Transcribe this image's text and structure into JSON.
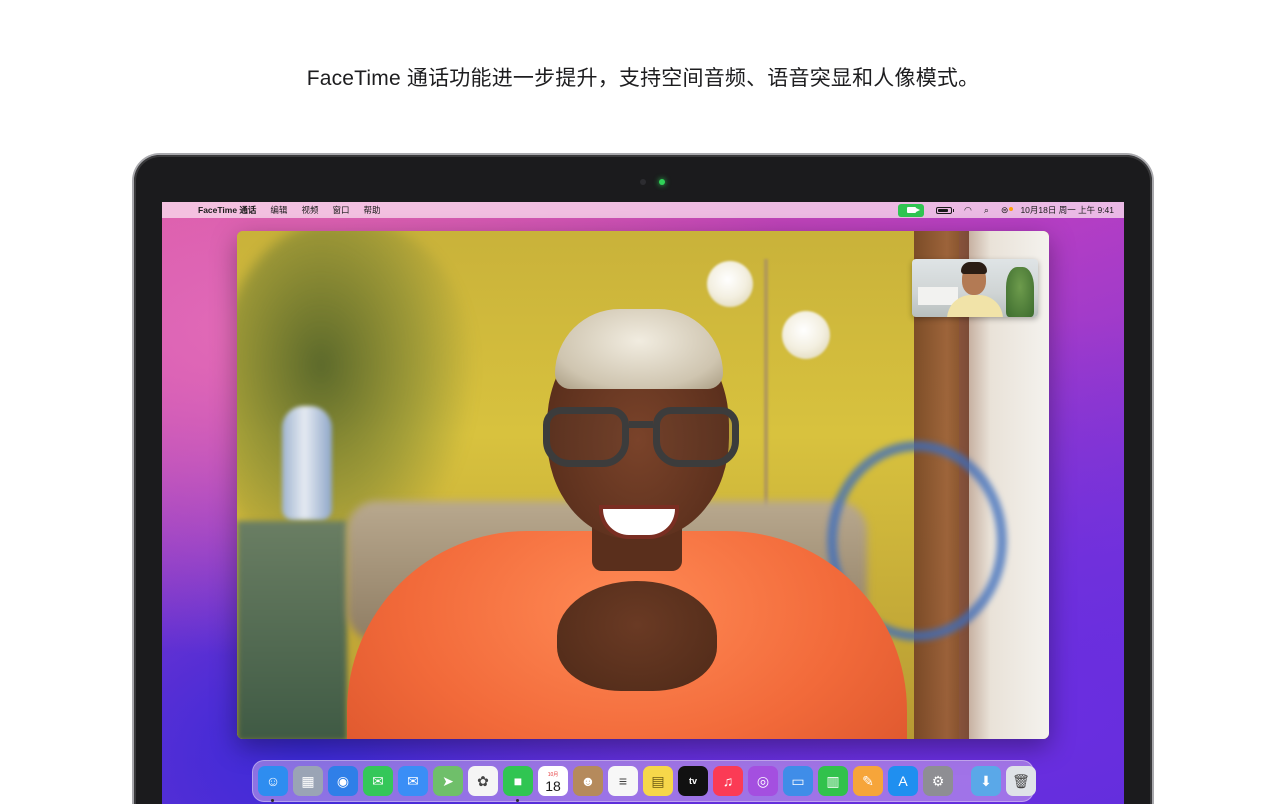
{
  "headline": "FaceTime 通话功能进一步提升，支持空间音频、语音突显和人像模式。",
  "menubar": {
    "apple_glyph": "",
    "app_name": "FaceTime 通话",
    "menus": [
      "编辑",
      "视频",
      "窗口",
      "帮助"
    ],
    "clock": "10月18日 周一 上午 9:41",
    "status_icons": [
      "facetime-indicator-icon",
      "battery-icon",
      "wifi-icon",
      "search-icon",
      "control-center-icon"
    ]
  },
  "colors": {
    "facetime_indicator": "#30c552",
    "camera_led": "#30d158",
    "shirt": "#f26a3a"
  },
  "calendar_icon": {
    "month": "10月",
    "day": "18"
  },
  "dock": {
    "apps": [
      {
        "name": "finder",
        "glyph": "☺",
        "color": "#2e8df0",
        "running": true
      },
      {
        "name": "launchpad",
        "glyph": "▦",
        "color": "#9aa4b5",
        "running": false
      },
      {
        "name": "safari",
        "glyph": "◉",
        "color": "#2f7fe8",
        "running": false
      },
      {
        "name": "messages",
        "glyph": "✉",
        "color": "#34c759",
        "running": false
      },
      {
        "name": "mail",
        "glyph": "✉",
        "color": "#3a8ef6",
        "running": false
      },
      {
        "name": "maps",
        "glyph": "➤",
        "color": "#6fbf6a",
        "running": false
      },
      {
        "name": "photos",
        "glyph": "✿",
        "color": "#f5f5f5",
        "running": false
      },
      {
        "name": "facetime",
        "glyph": "■",
        "color": "#30c552",
        "running": true
      },
      {
        "name": "calendar",
        "glyph": "",
        "color": "#ffffff",
        "running": false
      },
      {
        "name": "contacts",
        "glyph": "☻",
        "color": "#b58a5c",
        "running": false
      },
      {
        "name": "reminders",
        "glyph": "≡",
        "color": "#f7f7f7",
        "running": false
      },
      {
        "name": "notes",
        "glyph": "▤",
        "color": "#f6d74a",
        "running": false
      },
      {
        "name": "tv",
        "glyph": "tv",
        "color": "#111111",
        "running": false
      },
      {
        "name": "music",
        "glyph": "♫",
        "color": "#fb3b55",
        "running": false
      },
      {
        "name": "podcasts",
        "glyph": "◎",
        "color": "#a44fe0",
        "running": false
      },
      {
        "name": "keynote",
        "glyph": "▭",
        "color": "#3f8de8",
        "running": false
      },
      {
        "name": "numbers",
        "glyph": "▥",
        "color": "#31c24c",
        "running": false
      },
      {
        "name": "pages",
        "glyph": "✎",
        "color": "#f6a53a",
        "running": false
      },
      {
        "name": "app-store",
        "glyph": "A",
        "color": "#1f8ff0",
        "running": false
      },
      {
        "name": "system-preferences",
        "glyph": "⚙",
        "color": "#8e8e93",
        "running": false
      }
    ],
    "trailing": [
      {
        "name": "downloads-folder",
        "glyph": "⬇",
        "color": "#5aa8e8"
      },
      {
        "name": "trash",
        "glyph": "🗑",
        "color": "#dfe3e8"
      }
    ]
  }
}
